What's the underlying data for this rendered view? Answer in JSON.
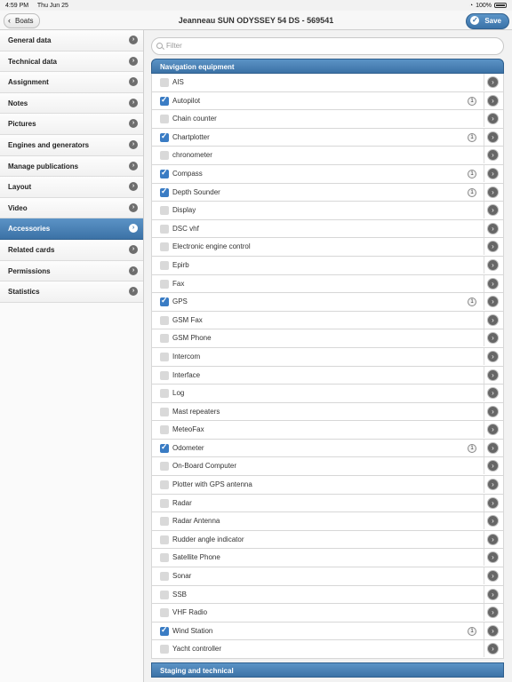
{
  "status_bar": {
    "time": "4:59 PM",
    "date": "Thu Jun 25",
    "battery": "100%"
  },
  "nav": {
    "back_label": "Boats",
    "title": "Jeanneau SUN ODYSSEY 54 DS - 569541",
    "save_label": "Save"
  },
  "sidebar": {
    "items": [
      {
        "label": "General data"
      },
      {
        "label": "Technical data"
      },
      {
        "label": "Assignment"
      },
      {
        "label": "Notes"
      },
      {
        "label": "Pictures"
      },
      {
        "label": "Engines and generators"
      },
      {
        "label": "Manage publications"
      },
      {
        "label": "Layout"
      },
      {
        "label": "Video"
      },
      {
        "label": "Accessories",
        "active": true
      },
      {
        "label": "Related cards"
      },
      {
        "label": "Permissions"
      },
      {
        "label": "Statistics"
      }
    ]
  },
  "filter": {
    "placeholder": "Filter"
  },
  "sections": {
    "navigation": "Navigation equipment",
    "staging": "Staging and technical"
  },
  "items": [
    {
      "label": "AIS",
      "checked": false,
      "count": ""
    },
    {
      "label": "Autopilot",
      "checked": true,
      "count": "1"
    },
    {
      "label": "Chain counter",
      "checked": false,
      "count": ""
    },
    {
      "label": "Chartplotter",
      "checked": true,
      "count": "1"
    },
    {
      "label": "chronometer",
      "checked": false,
      "count": ""
    },
    {
      "label": "Compass",
      "checked": true,
      "count": "1"
    },
    {
      "label": "Depth Sounder",
      "checked": true,
      "count": "1"
    },
    {
      "label": "Display",
      "checked": false,
      "count": ""
    },
    {
      "label": "DSC vhf",
      "checked": false,
      "count": ""
    },
    {
      "label": "Electronic engine control",
      "checked": false,
      "count": ""
    },
    {
      "label": "Epirb",
      "checked": false,
      "count": ""
    },
    {
      "label": "Fax",
      "checked": false,
      "count": ""
    },
    {
      "label": "GPS",
      "checked": true,
      "count": "1"
    },
    {
      "label": "GSM Fax",
      "checked": false,
      "count": ""
    },
    {
      "label": "GSM Phone",
      "checked": false,
      "count": ""
    },
    {
      "label": "Intercom",
      "checked": false,
      "count": ""
    },
    {
      "label": "Interface",
      "checked": false,
      "count": ""
    },
    {
      "label": "Log",
      "checked": false,
      "count": ""
    },
    {
      "label": "Mast repeaters",
      "checked": false,
      "count": ""
    },
    {
      "label": "MeteoFax",
      "checked": false,
      "count": ""
    },
    {
      "label": "Odometer",
      "checked": true,
      "count": "1"
    },
    {
      "label": "On-Board Computer",
      "checked": false,
      "count": ""
    },
    {
      "label": "Plotter with GPS antenna",
      "checked": false,
      "count": ""
    },
    {
      "label": "Radar",
      "checked": false,
      "count": ""
    },
    {
      "label": "Radar Antenna",
      "checked": false,
      "count": ""
    },
    {
      "label": "Rudder angle indicator",
      "checked": false,
      "count": ""
    },
    {
      "label": "Satellite Phone",
      "checked": false,
      "count": ""
    },
    {
      "label": "Sonar",
      "checked": false,
      "count": ""
    },
    {
      "label": "SSB",
      "checked": false,
      "count": ""
    },
    {
      "label": "VHF Radio",
      "checked": false,
      "count": ""
    },
    {
      "label": "Wind Station",
      "checked": true,
      "count": "1"
    },
    {
      "label": "Yacht controller",
      "checked": false,
      "count": ""
    }
  ]
}
